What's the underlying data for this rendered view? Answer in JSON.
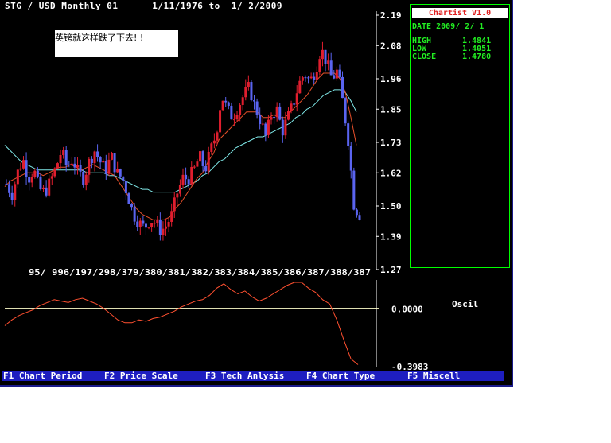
{
  "header": {
    "symbol": "STG / USD",
    "period": "Monthly 01",
    "date_range": "1/11/1976 to  1/ 2/2009"
  },
  "note": {
    "text": "英镑就这样跌了下去! !"
  },
  "panel": {
    "app_name": "Chartist V1.0",
    "date": "DATE 2009/ 2/ 1",
    "high_label": "HIGH",
    "high_value": "1.4841",
    "low_label": "LOW",
    "low_value": "1.4051",
    "close_label": "CLOSE",
    "close_value": "1.4780"
  },
  "function_keys": [
    "F1 Chart Period",
    "F2 Price Scale",
    "F3 Tech Anlysis",
    "F4 Chart Type",
    "F5 Miscell"
  ],
  "colors": {
    "up_candle": "#e01e2e",
    "down_candle": "#5a64f0",
    "ma_short": "#e8502a",
    "ma_long": "#7fe8e8",
    "oscillator": "#ff5030",
    "zero_line": "#ffffcc",
    "panel_text": "#22ee22"
  },
  "chart_data": [
    {
      "type": "candlestick",
      "title": "STG / USD Monthly 01",
      "y_ticks": [
        "2.19",
        "2.08",
        "1.96",
        "1.85",
        "1.73",
        "1.62",
        "1.50",
        "1.39",
        "1.27"
      ],
      "ylim": [
        1.27,
        2.19
      ],
      "x_tick_labels": "95/ 996/197/298/379/380/381/382/383/384/385/386/387/388/387",
      "close_series": [
        1.58,
        1.54,
        1.62,
        1.67,
        1.6,
        1.63,
        1.56,
        1.55,
        1.59,
        1.64,
        1.7,
        1.64,
        1.67,
        1.62,
        1.6,
        1.66,
        1.7,
        1.66,
        1.63,
        1.68,
        1.62,
        1.6,
        1.54,
        1.47,
        1.44,
        1.42,
        1.45,
        1.44,
        1.41,
        1.43,
        1.47,
        1.55,
        1.6,
        1.6,
        1.63,
        1.68,
        1.63,
        1.7,
        1.76,
        1.9,
        1.85,
        1.82,
        1.86,
        1.9,
        1.93,
        1.86,
        1.81,
        1.75,
        1.83,
        1.85,
        1.77,
        1.82,
        1.87,
        1.94,
        1.98,
        1.95,
        1.99,
        2.07,
        2.02,
        1.96,
        1.99,
        1.87,
        1.73,
        1.5,
        1.47
      ],
      "ma_short_series": [
        1.57,
        1.59,
        1.6,
        1.61,
        1.62,
        1.62,
        1.62,
        1.61,
        1.62,
        1.63,
        1.64,
        1.64,
        1.65,
        1.64,
        1.63,
        1.64,
        1.65,
        1.64,
        1.63,
        1.62,
        1.61,
        1.58,
        1.55,
        1.52,
        1.49,
        1.47,
        1.46,
        1.45,
        1.45,
        1.45,
        1.46,
        1.49,
        1.51,
        1.54,
        1.57,
        1.6,
        1.62,
        1.66,
        1.69,
        1.74,
        1.76,
        1.78,
        1.8,
        1.82,
        1.84,
        1.84,
        1.84,
        1.82,
        1.82,
        1.83,
        1.82,
        1.82,
        1.84,
        1.86,
        1.88,
        1.9,
        1.93,
        1.96,
        1.98,
        1.98,
        1.98,
        1.96,
        1.91,
        1.82,
        1.72
      ],
      "ma_long_series": [
        1.72,
        1.7,
        1.68,
        1.66,
        1.65,
        1.64,
        1.63,
        1.63,
        1.63,
        1.63,
        1.63,
        1.63,
        1.63,
        1.63,
        1.63,
        1.62,
        1.62,
        1.62,
        1.62,
        1.61,
        1.61,
        1.6,
        1.59,
        1.58,
        1.57,
        1.56,
        1.56,
        1.55,
        1.55,
        1.55,
        1.55,
        1.55,
        1.56,
        1.57,
        1.58,
        1.59,
        1.61,
        1.62,
        1.64,
        1.66,
        1.67,
        1.69,
        1.71,
        1.72,
        1.73,
        1.74,
        1.75,
        1.75,
        1.76,
        1.77,
        1.78,
        1.79,
        1.8,
        1.82,
        1.83,
        1.85,
        1.86,
        1.88,
        1.9,
        1.91,
        1.92,
        1.92,
        1.91,
        1.88,
        1.84
      ]
    },
    {
      "type": "line",
      "title": "Oscil",
      "y_ticks": [
        "0.0000",
        "-0.3983"
      ],
      "ylim": [
        -0.3983,
        0.18
      ],
      "values": [
        -0.12,
        -0.08,
        -0.05,
        -0.03,
        -0.01,
        0.02,
        0.04,
        0.06,
        0.05,
        0.04,
        0.06,
        0.07,
        0.05,
        0.03,
        0.0,
        -0.04,
        -0.08,
        -0.1,
        -0.1,
        -0.08,
        -0.09,
        -0.07,
        -0.06,
        -0.04,
        -0.02,
        0.01,
        0.03,
        0.05,
        0.06,
        0.09,
        0.14,
        0.17,
        0.13,
        0.1,
        0.12,
        0.08,
        0.05,
        0.07,
        0.1,
        0.13,
        0.16,
        0.18,
        0.18,
        0.14,
        0.11,
        0.06,
        0.03,
        -0.08,
        -0.22,
        -0.35,
        -0.39
      ]
    }
  ]
}
